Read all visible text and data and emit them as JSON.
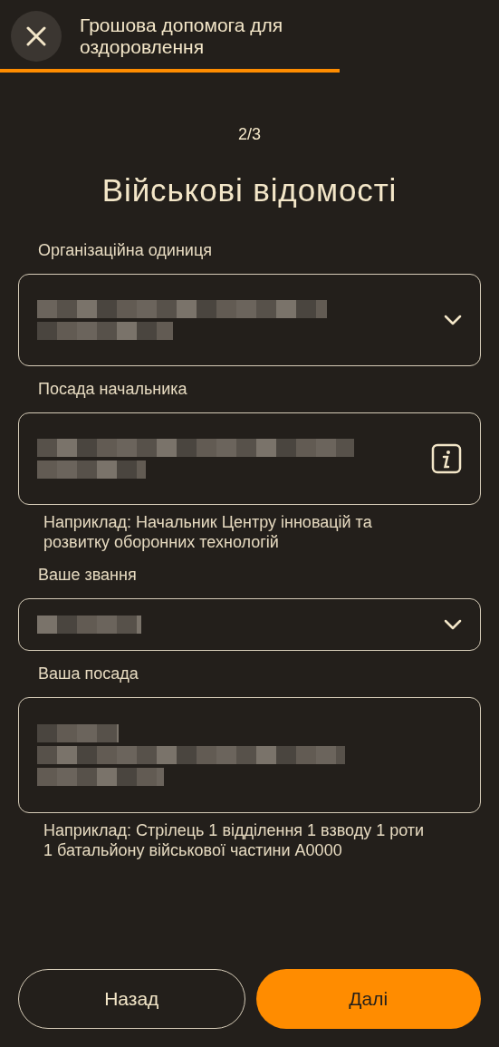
{
  "header": {
    "title": "Грошова допомога для оздоровлення"
  },
  "step": "2/3",
  "heading": "Військові відомості",
  "fields": [
    {
      "label": "Організаційна одиниця",
      "kind": "select",
      "redacted": true
    },
    {
      "label": "Посада начальника",
      "kind": "info",
      "redacted": true,
      "hint": "Наприклад: Начальник Центру інновацій та розвитку оборонних технологій"
    },
    {
      "label": "Ваше звання",
      "kind": "select",
      "redacted": true
    },
    {
      "label": "Ваша посада",
      "kind": "text",
      "redacted": true,
      "hint": "Наприклад: Стрілець 1 відділення 1 взводу 1 роти 1 батальйону військової частини А0000"
    }
  ],
  "buttons": [
    {
      "label": "Назад",
      "kind": "secondary"
    },
    {
      "label": "Далі",
      "kind": "primary"
    }
  ]
}
